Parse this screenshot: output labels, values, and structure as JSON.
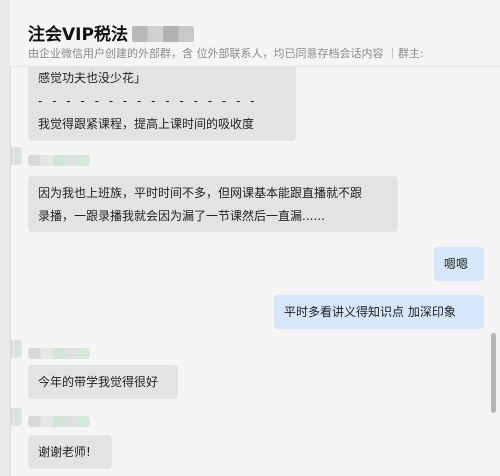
{
  "header": {
    "title": "注会VIP税法",
    "subtitle": "由企业微信用户创建的外部群，含    位外部联系人，均已同意存档会话内容  ｜群主: "
  },
  "messages": [
    {
      "lines": [
        "感觉功夫也没少花」",
        "- - - - - - - - - - - - - - - -",
        "我觉得跟紧课程，提高上课时间的吸收度"
      ]
    },
    {
      "lines": [
        "因为我也上班族，平时时间不多，但网课基本能跟直播就不跟",
        "录播，一跟录播我就会因为漏了一节课然后一直漏......"
      ]
    },
    {
      "lines": [
        "嗯嗯"
      ]
    },
    {
      "lines": [
        "平时多看讲义得知识点 加深印象"
      ]
    },
    {
      "lines": [
        "今年的带学我觉得很好"
      ]
    },
    {
      "lines": [
        "谢谢老师!"
      ]
    }
  ]
}
